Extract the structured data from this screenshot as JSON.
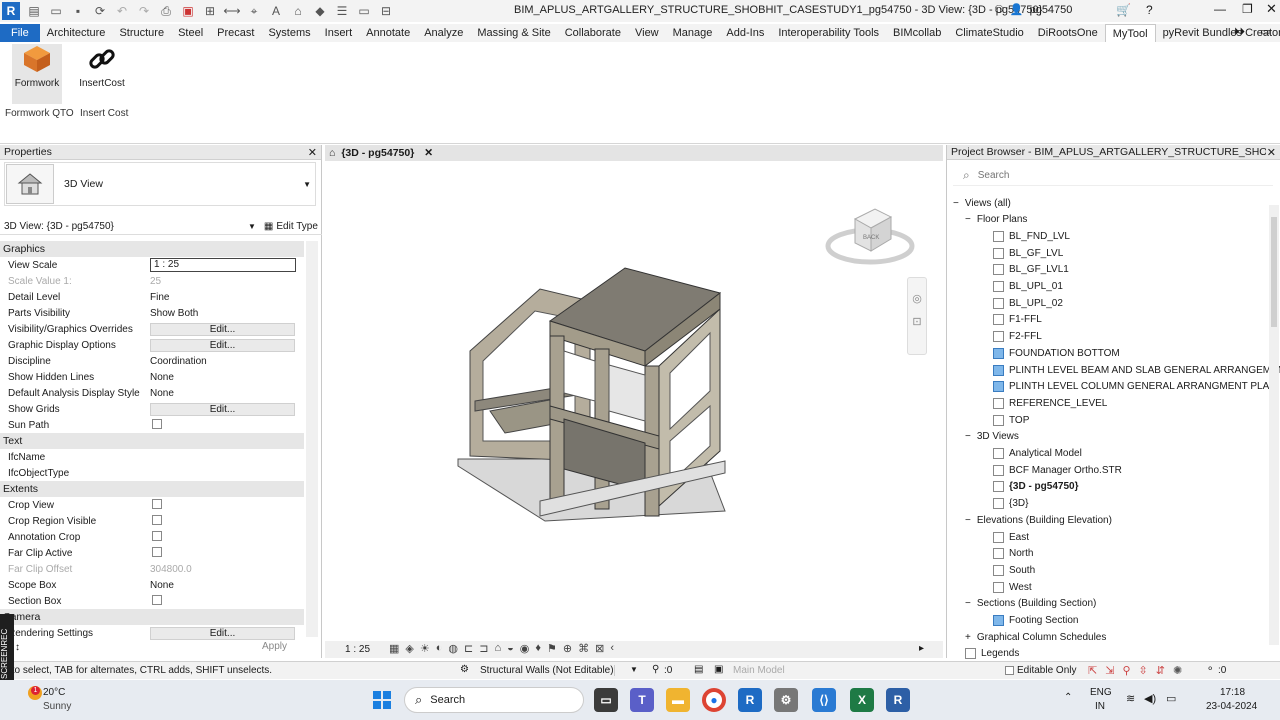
{
  "window": {
    "title": "BIM_APLUS_ARTGALLERY_STRUCTURE_SHOBHIT_CASESTUDY1_pg54750 - 3D View: {3D - pg54750}",
    "user": "pg54750"
  },
  "ribbon_tabs": [
    "File",
    "Architecture",
    "Structure",
    "Steel",
    "Precast",
    "Systems",
    "Insert",
    "Annotate",
    "Analyze",
    "Massing & Site",
    "Collaborate",
    "View",
    "Manage",
    "Add-Ins",
    "Interoperability Tools",
    "BIMcollab",
    "ClimateStudio",
    "DiRootsOne",
    "MyTool",
    "pyRevit Bundles Creator"
  ],
  "ribbon": {
    "formwork_label": "Formwork",
    "insertcost_label": "InsertCost",
    "panel1_name": "Formwork QTO",
    "panel2_name": "Insert Cost"
  },
  "properties": {
    "title": "Properties",
    "type_name": "3D View",
    "selector": "3D View: {3D - pg54750}",
    "edit_type": "Edit Type",
    "sections": {
      "graphics": "Graphics",
      "text": "Text",
      "extents": "Extents",
      "camera": "Camera"
    },
    "rows": {
      "view_scale_k": "View Scale",
      "view_scale_v": "1 : 25",
      "scale_value_k": "Scale Value    1:",
      "scale_value_v": "25",
      "detail_level_k": "Detail Level",
      "detail_level_v": "Fine",
      "parts_vis_k": "Parts Visibility",
      "parts_vis_v": "Show Both",
      "vg_k": "Visibility/Graphics Overrides",
      "gdo_k": "Graphic Display Options",
      "discipline_k": "Discipline",
      "discipline_v": "Coordination",
      "hidden_k": "Show Hidden Lines",
      "hidden_v": "None",
      "analysis_k": "Default Analysis Display Style",
      "analysis_v": "None",
      "grids_k": "Show Grids",
      "sunpath_k": "Sun Path",
      "ifcname_k": "IfcName",
      "ifctype_k": "IfcObjectType",
      "crop_k": "Crop View",
      "cropvis_k": "Crop Region Visible",
      "anncrop_k": "Annotation Crop",
      "farclip_k": "Far Clip Active",
      "farclipoff_k": "Far Clip Offset",
      "farclipoff_v": "304800.0",
      "scopebox_k": "Scope Box",
      "scopebox_v": "None",
      "secbox_k": "Section Box",
      "render_k": "Rendering Settings"
    },
    "edit_label": "Edit...",
    "apply": "Apply"
  },
  "view": {
    "tab_title": "{3D - pg54750}",
    "scale": "1 : 25",
    "viewcube_label": "BACK"
  },
  "browser": {
    "title": "Project Browser - BIM_APLUS_ARTGALLERY_STRUCTURE_SHOBHIT_CA...",
    "search_placeholder": "Search",
    "views_all": "Views (all)",
    "floor_plans": "Floor Plans",
    "floor_items": [
      "BL_FND_LVL",
      "BL_GF_LVL",
      "BL_GF_LVL1",
      "BL_UPL_01",
      "BL_UPL_02",
      "F1-FFL",
      "F2-FFL",
      "FOUNDATION BOTTOM",
      "PLINTH LEVEL BEAM AND SLAB GENERAL ARRANGEMENT",
      "PLINTH LEVEL COLUMN GENERAL ARRANGMENT PLAN",
      "REFERENCE_LEVEL",
      "TOP"
    ],
    "views3d": "3D Views",
    "views3d_items": [
      "Analytical Model",
      "BCF Manager Ortho.STR",
      "{3D - pg54750}",
      "{3D}"
    ],
    "elevations": "Elevations (Building Elevation)",
    "elev_items": [
      "East",
      "North",
      "South",
      "West"
    ],
    "sections": "Sections (Building Section)",
    "section_items": [
      "Footing Section"
    ],
    "schedules": "Graphical Column Schedules",
    "legends": "Legends"
  },
  "status": {
    "hint": "k to select, TAB for alternates, CTRL adds, SHIFT unselects.",
    "workset": "Structural Walls (Not Editable)",
    "count": ":0",
    "model": "Main Model",
    "editable_only": "Editable Only",
    "filter_count": ":0"
  },
  "taskbar": {
    "temp": "20°C",
    "weather": "Sunny",
    "search": "Search",
    "lang1": "ENG",
    "lang2": "IN",
    "time": "17:18",
    "date": "23-04-2024",
    "recorder": "SCREENREC"
  }
}
